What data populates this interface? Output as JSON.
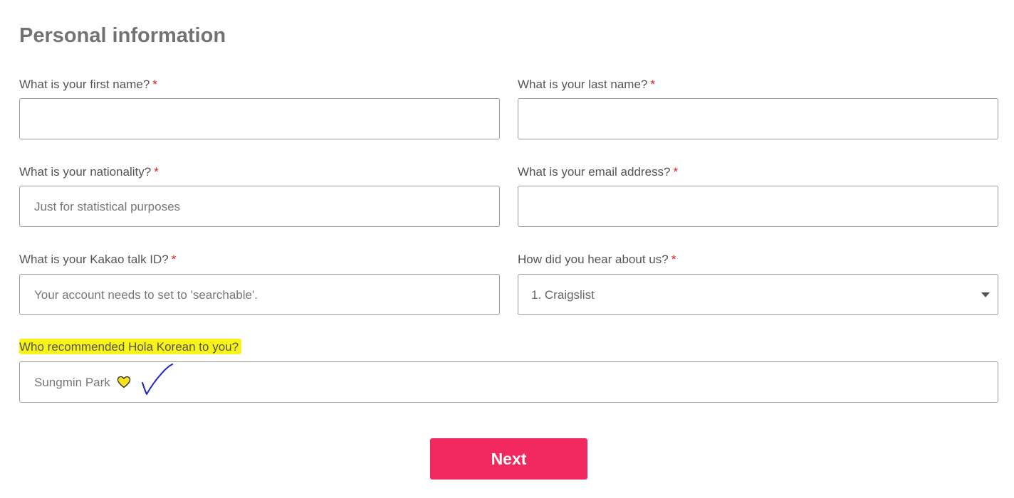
{
  "section": {
    "title": "Personal information"
  },
  "required_marker": "*",
  "fields": {
    "first_name": {
      "label": "What is your first name?",
      "value": "",
      "placeholder": ""
    },
    "last_name": {
      "label": "What is your last name?",
      "value": "",
      "placeholder": ""
    },
    "nationality": {
      "label": "What is your nationality?",
      "value": "",
      "placeholder": "Just for statistical purposes"
    },
    "email": {
      "label": "What is your email address?",
      "value": "",
      "placeholder": ""
    },
    "kakao": {
      "label": "What is your Kakao talk ID?",
      "value": "",
      "placeholder": "Your account needs to set to 'searchable'."
    },
    "heard_about": {
      "label": "How did you hear about us?",
      "selected": "1. Craigslist"
    },
    "recommended_by": {
      "label": "Who recommended Hola Korean to you?",
      "value": "Sungmin Park",
      "label_highlight_color": "#f8f41a"
    }
  },
  "annotations": {
    "heart_icon": "yellow-heart-icon",
    "heart_color": "#f8e21d",
    "check_icon": "handdrawn-checkmark-icon",
    "check_color": "#1d22c9"
  },
  "buttons": {
    "next_label": "Next",
    "next_color": "#f2295e"
  }
}
